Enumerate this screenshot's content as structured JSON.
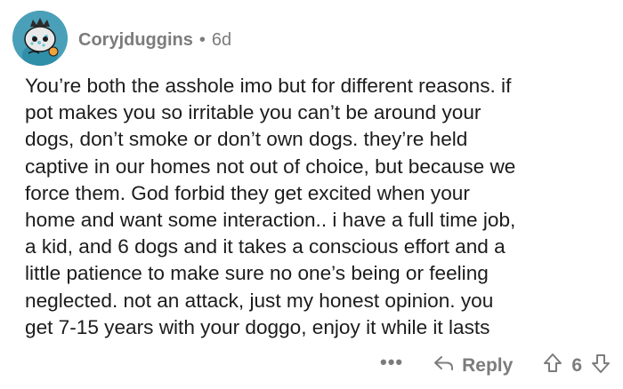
{
  "comment": {
    "username": "Coryjduggins",
    "separator": "•",
    "age": "6d",
    "body_lines": [
      "You’re both the asshole imo but for different reasons. if",
      "pot makes you so irritable you can’t be around your",
      "dogs, don’t smoke or don’t own dogs. they’re held",
      "captive in our homes not out of choice, but because we",
      "force them. God forbid they get excited when your",
      "home and want some interaction.. i have a full time job,",
      "a kid, and 6 dogs and it takes a conscious effort and a",
      "little patience to make sure no one’s being or feeling",
      "neglected. not an attack, just my honest opinion. you",
      "get 7-15 years with your doggo, enjoy it while it lasts"
    ]
  },
  "actions": {
    "more_label": "•••",
    "reply_label": "Reply",
    "vote_count": "6"
  },
  "colors": {
    "text": "#1c1c1c",
    "meta": "#7c7c7c",
    "avatar_bg": "#4aa0b8"
  },
  "icons": {
    "avatar": "snoo-avatar",
    "reply": "reply-arrow-icon",
    "upvote": "upvote-arrow-icon",
    "downvote": "downvote-arrow-icon",
    "more": "more-options-icon"
  }
}
